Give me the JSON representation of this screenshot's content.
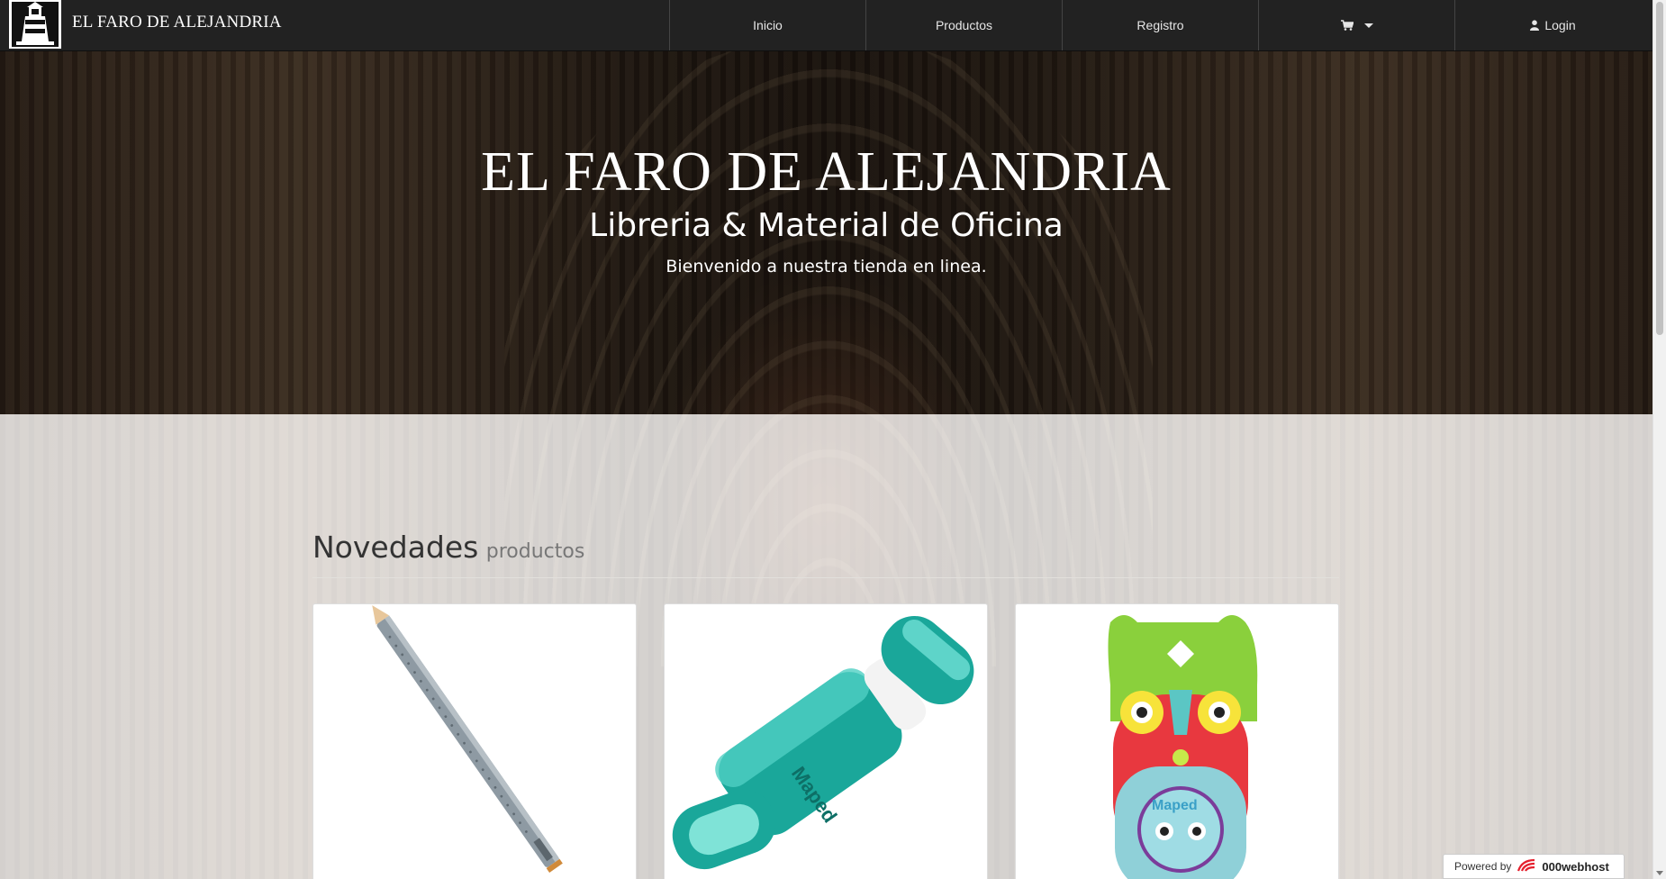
{
  "navbar": {
    "brand": "EL FARO DE ALEJANDRIA",
    "items": [
      {
        "label": "Inicio",
        "icon": ""
      },
      {
        "label": "Productos",
        "icon": ""
      },
      {
        "label": "Registro",
        "icon": ""
      },
      {
        "label": "",
        "icon": "shopping-cart-icon"
      },
      {
        "label": "Login",
        "icon": "user-icon"
      }
    ],
    "background": "#222222"
  },
  "hero": {
    "title": "EL FARO DE ALEJANDRIA",
    "subtitle": "Libreria & Material de Oficina",
    "tagline": "Bienvenido a nuestra tienda en linea."
  },
  "section": {
    "title": "Novedades",
    "subtitle": "productos"
  },
  "products": [
    {
      "image": "pencil-product-image",
      "accent": "#8e9aa3"
    },
    {
      "image": "eraser-sharpener-product-image",
      "accent": "#1aa79a"
    },
    {
      "image": "owl-sharpener-product-image",
      "accent": "#e8383f"
    }
  ],
  "footer_badge": {
    "powered": "Powered by",
    "host": "000webhost",
    "accent": "#e5202e"
  }
}
